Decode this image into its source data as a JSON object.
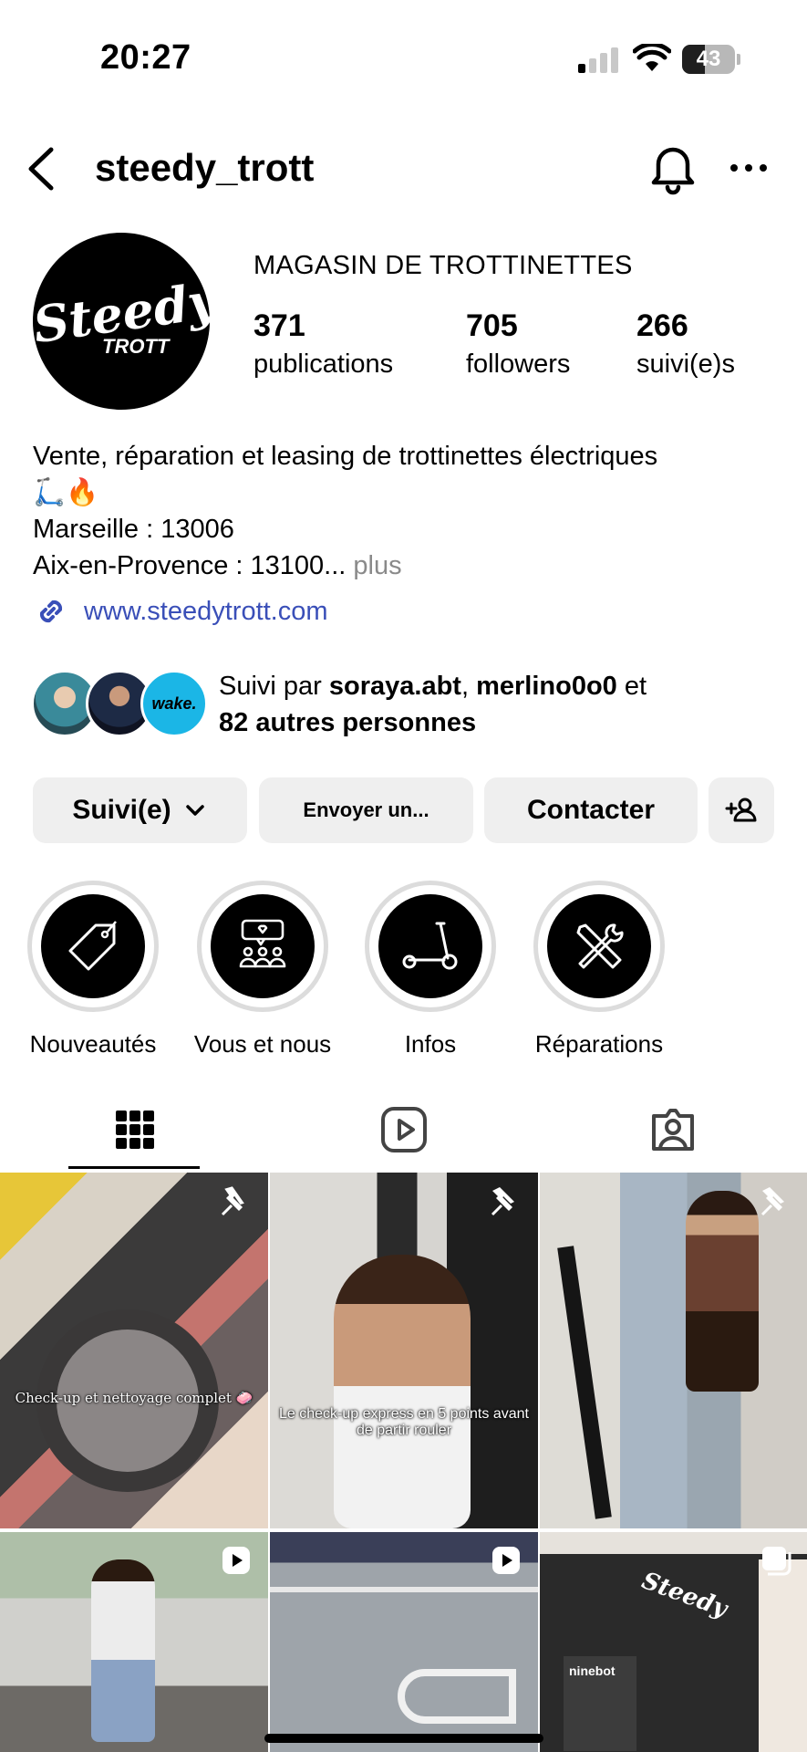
{
  "status_bar": {
    "time": "20:27",
    "battery_percent": 43,
    "battery_label": "43",
    "signal_bars": 1,
    "icons": [
      "signal-icon",
      "wifi-icon",
      "battery-icon"
    ]
  },
  "header": {
    "username": "steedy_trott",
    "icons": [
      "back-icon",
      "bell-icon",
      "more-icon"
    ]
  },
  "profile": {
    "avatar_script": "Steedy",
    "avatar_sub": "TROTT",
    "category": "MAGASIN DE TROTTINETTES",
    "stats": [
      {
        "value": "371",
        "label": "publications"
      },
      {
        "value": "705",
        "label": "followers"
      },
      {
        "value": "266",
        "label": "suivi(e)s"
      }
    ]
  },
  "bio": {
    "line1": "Vente, réparation et leasing de trottinettes électriques",
    "line2": "🛴🔥",
    "line3": "Marseille : 13006",
    "line4": "Aix-en-Provence : 13100...",
    "more": "plus",
    "link": "www.steedytrott.com"
  },
  "followed_by": {
    "prefix": "Suivi par",
    "user1": "soraya.abt",
    "separator": ",",
    "user2": "merlino0o0",
    "conj": "et",
    "others": "82 autres personnes",
    "third_avatar_text": "wake."
  },
  "actions": {
    "follow": "Suivi(e)",
    "message": "Envoyer un...",
    "contact": "Contacter"
  },
  "highlights": [
    {
      "label": "Nouveautés",
      "icon": "tag-icon"
    },
    {
      "label": "Vous et nous",
      "icon": "community-icon"
    },
    {
      "label": "Infos",
      "icon": "scooter-icon"
    },
    {
      "label": "Réparations",
      "icon": "tools-icon"
    }
  ],
  "tabs": [
    "grid-icon",
    "reels-icon",
    "tagged-icon"
  ],
  "posts": [
    {
      "caption": "Check-up et nettoyage complet 🧼",
      "badge": "pin-icon"
    },
    {
      "caption": "Le check-up express en 5 points avant de partir rouler",
      "badge": "pin-icon"
    },
    {
      "caption": "",
      "badge": "pin-icon"
    },
    {
      "caption": "",
      "badge": "reel-icon"
    },
    {
      "caption": "",
      "badge": "reel-icon"
    },
    {
      "caption": "",
      "badge": "carousel-icon",
      "sign_text": "Steedy",
      "store_text": "ninebot"
    }
  ],
  "colors": {
    "link": "#3a4fb8",
    "button_bg": "#efefef",
    "muted": "#8a8a8a"
  }
}
